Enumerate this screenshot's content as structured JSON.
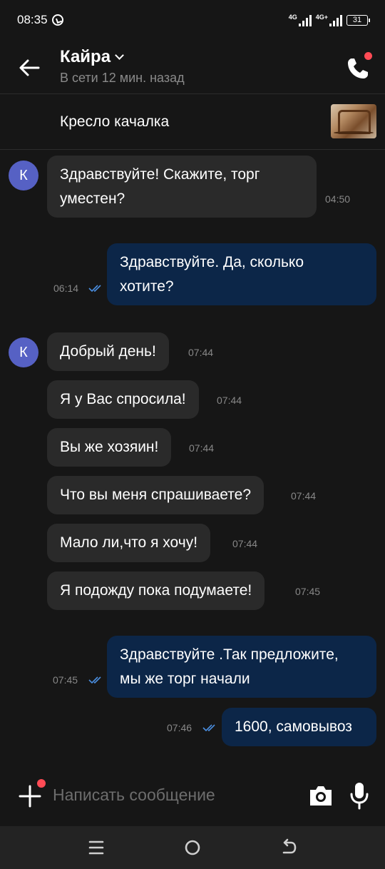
{
  "status_bar": {
    "time": "08:35",
    "network1": "4G",
    "network2": "4G+",
    "battery": "31"
  },
  "header": {
    "name": "Кайра",
    "status": "В сети 12 мин. назад"
  },
  "item": {
    "title": "Кресло качалка"
  },
  "avatar_letter": "К",
  "messages": [
    {
      "direction": "in",
      "text_lines": [
        "Здравствуйте! Скажите, торг",
        "уместен?"
      ],
      "time": "04:50"
    },
    {
      "direction": "out",
      "text_lines": [
        "Здравствуйте. Да, сколько",
        "хотите?"
      ],
      "time": "06:14"
    },
    {
      "direction": "in",
      "text_lines": [
        "Добрый день!"
      ],
      "time": "07:44"
    },
    {
      "direction": "in",
      "text_lines": [
        "Я у Вас спросила!"
      ],
      "time": "07:44"
    },
    {
      "direction": "in",
      "text_lines": [
        "Вы же хозяин!"
      ],
      "time": "07:44"
    },
    {
      "direction": "in",
      "text_lines": [
        "Что вы меня спрашиваете?"
      ],
      "time": "07:44"
    },
    {
      "direction": "in",
      "text_lines": [
        "Мало ли,что я хочу!"
      ],
      "time": "07:44"
    },
    {
      "direction": "in",
      "text_lines": [
        "Я подожду пока подумаете!"
      ],
      "time": "07:45"
    },
    {
      "direction": "out",
      "text_lines": [
        "Здравствуйте .Так предложите,",
        "мы же торг начали"
      ],
      "time": "07:45"
    },
    {
      "direction": "out",
      "text_lines": [
        "1600, самовывоз"
      ],
      "time": "07:46"
    }
  ],
  "composer": {
    "placeholder": "Написать сообщение"
  },
  "icons": {
    "back": "arrow-left-icon",
    "phone": "phone-icon",
    "plus": "plus-icon",
    "camera": "camera-icon",
    "mic": "microphone-icon",
    "nav_menu": "menu-icon",
    "nav_home": "home-icon",
    "nav_back": "back-icon"
  },
  "colors": {
    "background": "#161616",
    "incoming_bubble": "#2a2a2a",
    "outgoing_bubble": "#0c2648",
    "avatar": "#5661c4",
    "notification_dot": "#ff4b55",
    "read_ticks": "#4a8ee0"
  }
}
